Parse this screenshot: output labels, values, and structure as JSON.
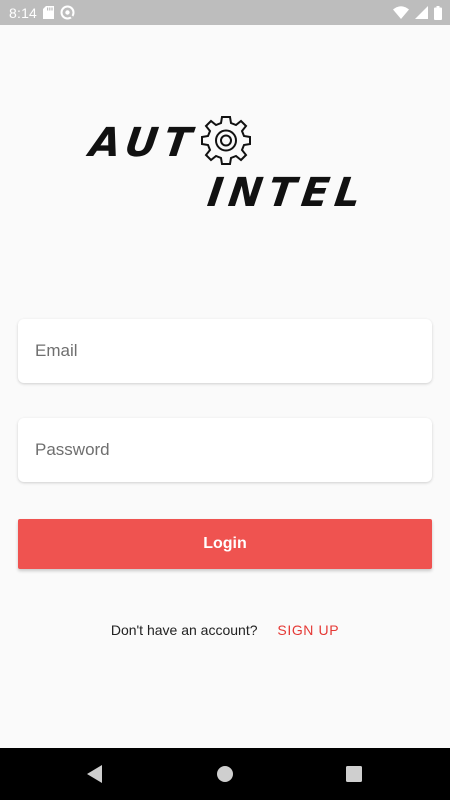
{
  "status_bar": {
    "time": "8:14",
    "icons": [
      "sd-card-icon",
      "sync-icon",
      "wifi-icon",
      "signal-icon",
      "battery-icon"
    ]
  },
  "logo": {
    "line1": "AUT",
    "line2": "INTEL",
    "icon": "gear-icon"
  },
  "form": {
    "email_placeholder": "Email",
    "password_placeholder": "Password",
    "login_label": "Login"
  },
  "signup": {
    "prompt": "Don't have an account?",
    "link": "SIGN UP"
  },
  "nav_bar": {
    "icons": [
      "back-icon",
      "home-icon",
      "recents-icon"
    ]
  },
  "colors": {
    "accent": "#ef5350",
    "link": "#e53935",
    "status_bar": "#bdbdbd",
    "background": "#fafafa"
  }
}
